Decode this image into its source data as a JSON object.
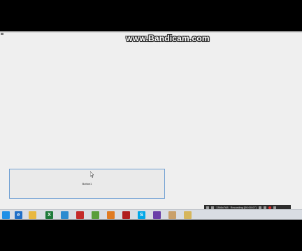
{
  "watermark": {
    "text": "www.Bandicam.com"
  },
  "form": {
    "button_label": "Button1"
  },
  "recorder": {
    "resolution": "1366x768",
    "status": "Recording [00:00:07]"
  },
  "taskbar": {
    "items": [
      {
        "name": "windows-start-icon",
        "glyph": "",
        "color": "#1e8fe6"
      },
      {
        "name": "internet-explorer-icon",
        "glyph": "e",
        "color": "#1f6fc7"
      },
      {
        "name": "file-explorer-icon",
        "glyph": "",
        "color": "#e8b840"
      },
      {
        "name": "excel-icon",
        "glyph": "X",
        "color": "#1d7a3a"
      },
      {
        "name": "app-icon",
        "glyph": "",
        "color": "#2c8bd0"
      },
      {
        "name": "record-app-icon",
        "glyph": "",
        "color": "#c42a2a"
      },
      {
        "name": "chrome-icon",
        "glyph": "",
        "color": "#5a9e3a"
      },
      {
        "name": "powerpoint-icon",
        "glyph": "",
        "color": "#e07b22"
      },
      {
        "name": "bandicam-icon",
        "glyph": "",
        "color": "#b11e1e"
      },
      {
        "name": "skype-icon",
        "glyph": "S",
        "color": "#00a7e8"
      },
      {
        "name": "visual-studio-icon",
        "glyph": "",
        "color": "#6a3fa8"
      },
      {
        "name": "user-icon",
        "glyph": "",
        "color": "#c9a06a"
      },
      {
        "name": "form-app-icon",
        "glyph": "",
        "color": "#d6b65c"
      }
    ]
  }
}
